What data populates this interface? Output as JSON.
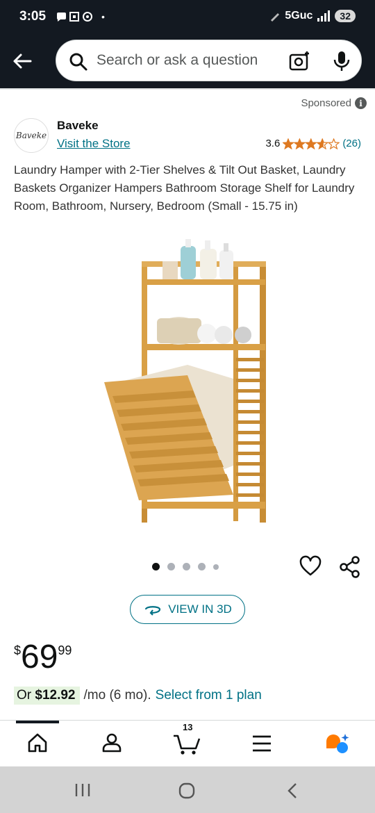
{
  "status": {
    "time": "3:05",
    "network": "5Guc",
    "battery": "32"
  },
  "header": {
    "search_placeholder": "Search or ask a question",
    "icons": [
      "back-arrow-icon",
      "search-icon",
      "camera-icon",
      "microphone-icon"
    ]
  },
  "ad": {
    "sponsored_label": "Sponsored",
    "info_glyph": "i"
  },
  "brand": {
    "logo_text": "Baveke",
    "name": "Baveke",
    "store_link": "Visit the Store"
  },
  "rating": {
    "value": "3.6",
    "stars": 3.6,
    "count": "(26)"
  },
  "product": {
    "title": "Laundry Hamper with 2-Tier Shelves & Tilt Out Basket, Laundry Baskets Organizer Hampers Bathroom Storage Shelf for Laundry Room, Bathroom, Nursery, Bedroom (Small - 15.75 in)",
    "image_count": 5,
    "active_image": 0
  },
  "actions": {
    "view_3d_label": "VIEW IN 3D"
  },
  "price": {
    "currency": "$",
    "whole": "69",
    "fraction": "99"
  },
  "plan": {
    "or_label": "Or",
    "monthly": "$12.92",
    "terms": "/mo (6 mo).",
    "link": "Select from 1 plan"
  },
  "tabbar": {
    "cart_count": "13",
    "tabs": [
      "home-icon",
      "account-icon",
      "cart-icon",
      "menu-icon",
      "rufus-icon"
    ]
  },
  "colors": {
    "header_bg": "#131921",
    "link": "#007185",
    "star": "#de7921",
    "plan_bg": "#e6f4e0"
  }
}
